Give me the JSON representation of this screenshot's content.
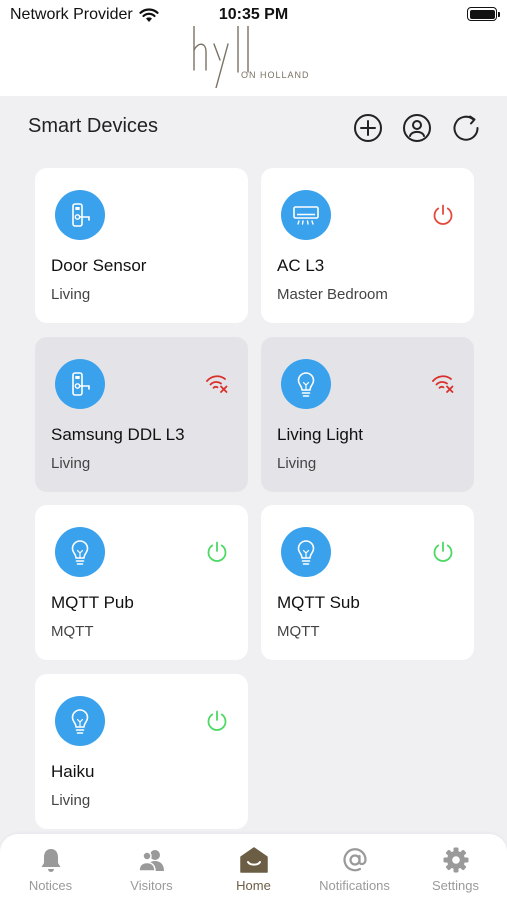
{
  "status_bar": {
    "carrier": "Network Provider",
    "time": "10:35 PM"
  },
  "brand": {
    "subtitle": "ON HOLLAND",
    "color": "#7a7264"
  },
  "header": {
    "title": "Smart Devices",
    "actions": [
      "add-icon",
      "user-icon",
      "refresh-icon"
    ]
  },
  "colors": {
    "device_icon_bg": "#3aa2ec",
    "power_off": "#e34a3f",
    "power_on": "#4cd964",
    "wifi_off": "#d9302c",
    "active_tab": "#6b5e45",
    "inactive_tab": "#9a9a9a"
  },
  "devices": [
    {
      "name": "Door Sensor",
      "room": "Living",
      "type": "door-lock",
      "state": "none",
      "offline": false
    },
    {
      "name": "AC L3",
      "room": "Master Bedroom",
      "type": "air-conditioner",
      "state": "power-off",
      "offline": false
    },
    {
      "name": "Samsung DDL L3",
      "room": "Living",
      "type": "door-lock",
      "state": "wifi-off",
      "offline": true
    },
    {
      "name": "Living Light",
      "room": "Living",
      "type": "light-bulb",
      "state": "wifi-off",
      "offline": true
    },
    {
      "name": "MQTT Pub",
      "room": "MQTT",
      "type": "light-bulb",
      "state": "power-on",
      "offline": false
    },
    {
      "name": "MQTT Sub",
      "room": "MQTT",
      "type": "light-bulb",
      "state": "power-on",
      "offline": false
    },
    {
      "name": "Haiku",
      "room": "Living",
      "type": "light-bulb",
      "state": "power-on",
      "offline": false
    }
  ],
  "tabs": [
    {
      "label": "Notices",
      "icon": "bell-icon",
      "active": false
    },
    {
      "label": "Visitors",
      "icon": "visitors-icon",
      "active": false
    },
    {
      "label": "Home",
      "icon": "home-icon",
      "active": true
    },
    {
      "label": "Notifications",
      "icon": "at-icon",
      "active": false
    },
    {
      "label": "Settings",
      "icon": "gear-icon",
      "active": false
    }
  ]
}
